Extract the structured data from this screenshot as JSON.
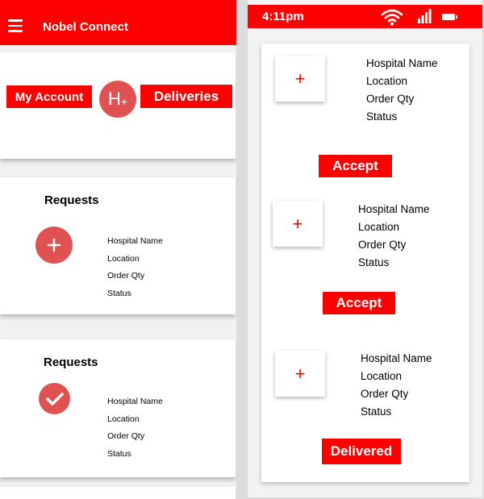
{
  "colors": {
    "brand_red": "#fe0000",
    "circle_red": "#e05252"
  },
  "app": {
    "title": "Nobel Connect"
  },
  "home": {
    "my_account_label": "My Account",
    "deliveries_label": "Deliveries",
    "logo_text": "H+",
    "requests": [
      {
        "title": "Requests",
        "icon": "plus-icon",
        "fields": [
          "Hospital Name",
          "Location",
          "Order Qty",
          "Status"
        ]
      },
      {
        "title": "Requests",
        "icon": "check-icon",
        "fields": [
          "Hospital Name",
          "Location",
          "Order Qty",
          "Status"
        ]
      }
    ]
  },
  "status_bar": {
    "time": "4:11pm"
  },
  "deliveries": [
    {
      "icon": "plus-icon",
      "fields": [
        "Hospital Name",
        "Location",
        "Order Qty",
        "Status"
      ],
      "action": "Accept"
    },
    {
      "icon": "plus-icon",
      "fields": [
        "Hospital Name",
        "Location",
        "Order Qty",
        "Status"
      ],
      "action": "Accept"
    },
    {
      "icon": "plus-icon",
      "fields": [
        "Hospital Name",
        "Location",
        "Order Qty",
        "Status"
      ],
      "action": "Delivered"
    }
  ]
}
